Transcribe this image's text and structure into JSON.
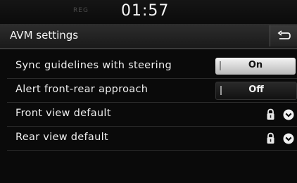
{
  "status": {
    "indicator": "REG",
    "time": "01:57"
  },
  "header": {
    "title": "AVM settings",
    "back_icon": "back-arrow-icon"
  },
  "settings": {
    "sync": {
      "label": "Sync guidelines with steering",
      "value": "On"
    },
    "alert": {
      "label": "Alert front-rear approach",
      "value": "Off"
    },
    "front": {
      "label": "Front view default",
      "icons": [
        "lock-icon",
        "chevron-down-icon"
      ]
    },
    "rear": {
      "label": "Rear view default",
      "icons": [
        "lock-icon",
        "chevron-down-icon"
      ]
    }
  },
  "colors": {
    "background": "#0a0a0a",
    "header": "#222222",
    "toggle_on": "#dcdcdc"
  }
}
